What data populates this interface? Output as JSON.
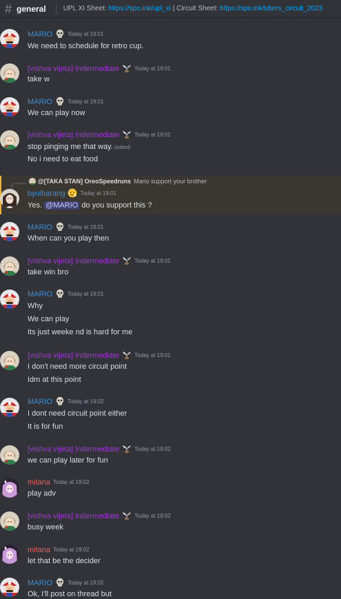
{
  "header": {
    "channel_name": "general",
    "topic_label1": "UPL XI Sheet: ",
    "topic_link1": "https://spo.ink/upl_xi",
    "topic_sep": " | ",
    "topic_label2": "Circuit Sheet: ",
    "topic_link2": "https://spo.ink/ubers_circuit_2023"
  },
  "colors": {
    "background": "#313338",
    "mario": "#3c8fd6",
    "vishva": "#a136d8",
    "mitana": "#ef5d59",
    "link": "#00a8fc",
    "highlight": "#f0b232"
  },
  "messages": [
    {
      "author": "MARIO",
      "badge": "skull-icon",
      "timestamp": "Today at 19:01",
      "lines": [
        "We need to schedule for retro cup."
      ]
    },
    {
      "author": "[vishva vijeta] Indermediate",
      "badge": "plant-icon",
      "timestamp": "Today at 19:01",
      "lines": [
        "take w"
      ]
    },
    {
      "author": "MARIO",
      "badge": "skull-icon",
      "timestamp": "Today at 19:01",
      "lines": [
        "We can play now"
      ]
    },
    {
      "author": "[vishva vijeta] Indermediate",
      "badge": "plant-icon",
      "timestamp": "Today at 19:01",
      "lines": [
        "stop pinging me that way.",
        "No i need to eat food"
      ],
      "edited": "(edited)"
    },
    {
      "author": "byulharang",
      "badge": "face-emoji-icon",
      "timestamp": "Today at 19:01",
      "reply_author": "@[TAKA STAN] OreoSpeedruns",
      "reply_text": "Mario support your brother",
      "text_before": "Yes. ",
      "mention": "@MARIO",
      "text_after": " do you support this ?"
    },
    {
      "author": "MARIO",
      "badge": "skull-icon",
      "timestamp": "Today at 19:01",
      "lines": [
        "When can you play then"
      ]
    },
    {
      "author": "[vishva vijeta] Indermediate",
      "badge": "plant-icon",
      "timestamp": "Today at 19:01",
      "lines": [
        "take win bro"
      ]
    },
    {
      "author": "MARIO",
      "badge": "skull-icon",
      "timestamp": "Today at 19:01",
      "lines": [
        "Why",
        "We can play",
        "Its just weeke nd is hard for me"
      ]
    },
    {
      "author": "[vishva vijeta] Indermediate",
      "badge": "plant-icon",
      "timestamp": "Today at 19:01",
      "lines": [
        "I don't need more circuit point",
        "Idm at this point"
      ]
    },
    {
      "author": "MARIO",
      "badge": "skull-icon",
      "timestamp": "Today at 19:02",
      "lines": [
        "I dont need circuit point either",
        "It is for fun"
      ]
    },
    {
      "author": "[vishva vijeta] Indermediate",
      "badge": "plant-icon",
      "timestamp": "Today at 19:02",
      "lines": [
        "we can play later for fun"
      ]
    },
    {
      "author": "mitana",
      "timestamp": "Today at 19:02",
      "lines": [
        "play adv"
      ]
    },
    {
      "author": "[vishva vijeta] Indermediate",
      "badge": "plant-icon",
      "timestamp": "Today at 19:02",
      "lines": [
        "busy week"
      ]
    },
    {
      "author": "mitana",
      "timestamp": "Today at 19:02",
      "lines": [
        "let that be the decider"
      ]
    },
    {
      "author": "MARIO",
      "badge": "skull-icon",
      "timestamp": "Today at 19:02",
      "lines": [
        "Ok, I'll post on thread but"
      ]
    }
  ]
}
